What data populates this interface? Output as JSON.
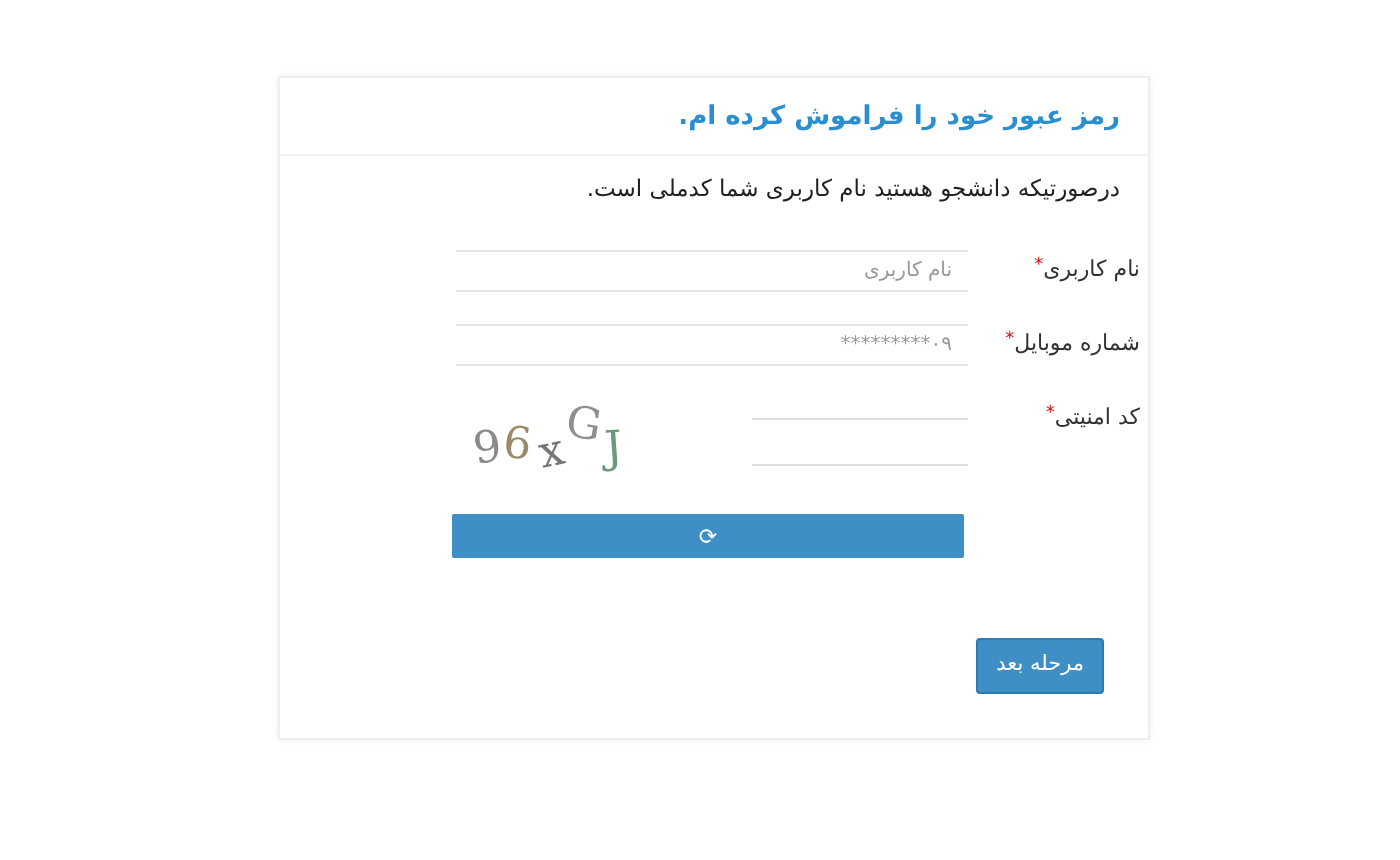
{
  "title": "رمز عبور خود را فراموش کرده ام.",
  "note": "درصورتیکه دانشجو هستید نام کاربری شما کدملی است.",
  "fields": [
    {
      "kind": "text",
      "label": "نام کاربری",
      "required_mark": "*",
      "placeholder": "نام کاربری"
    },
    {
      "kind": "text",
      "label": "شماره موبایل",
      "required_mark": "*",
      "placeholder": "۰۹*********"
    },
    {
      "kind": "captcha",
      "label": "کد امنیتی",
      "required_mark": "*",
      "captcha": "96xGJ"
    }
  ],
  "refresh_icon": "⟳",
  "next_button": "مرحله بعد"
}
